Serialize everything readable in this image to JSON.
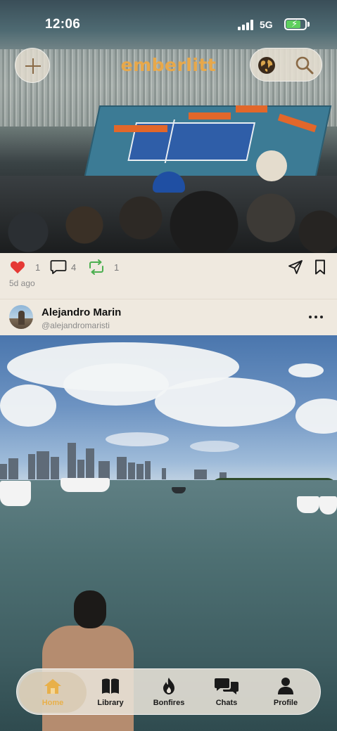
{
  "status_bar": {
    "time": "12:06",
    "network": "5G",
    "battery_charging": true
  },
  "header": {
    "logo": "emberlitt",
    "add_icon": "plus-icon",
    "globe_icon": "globe-icon",
    "search_icon": "search-icon",
    "accent_color": "#e8a84a"
  },
  "post": {
    "image_description_icon": "stadium-photo",
    "actions": {
      "like_count": "1",
      "comment_count": "4",
      "repost_count": "1",
      "like_color": "#e53935",
      "repost_color": "#4caf50"
    },
    "time_ago": "5d ago"
  },
  "next_post": {
    "author_name": "Alejandro Marin",
    "author_handle": "@alejandromaristi"
  },
  "bottom_nav": {
    "items": [
      {
        "label": "Home",
        "icon": "home-icon",
        "active": true
      },
      {
        "label": "Library",
        "icon": "book-icon",
        "active": false
      },
      {
        "label": "Bonfires",
        "icon": "flame-icon",
        "active": false
      },
      {
        "label": "Chats",
        "icon": "chat-bubbles-icon",
        "active": false
      },
      {
        "label": "Profile",
        "icon": "person-icon",
        "active": false
      }
    ]
  }
}
